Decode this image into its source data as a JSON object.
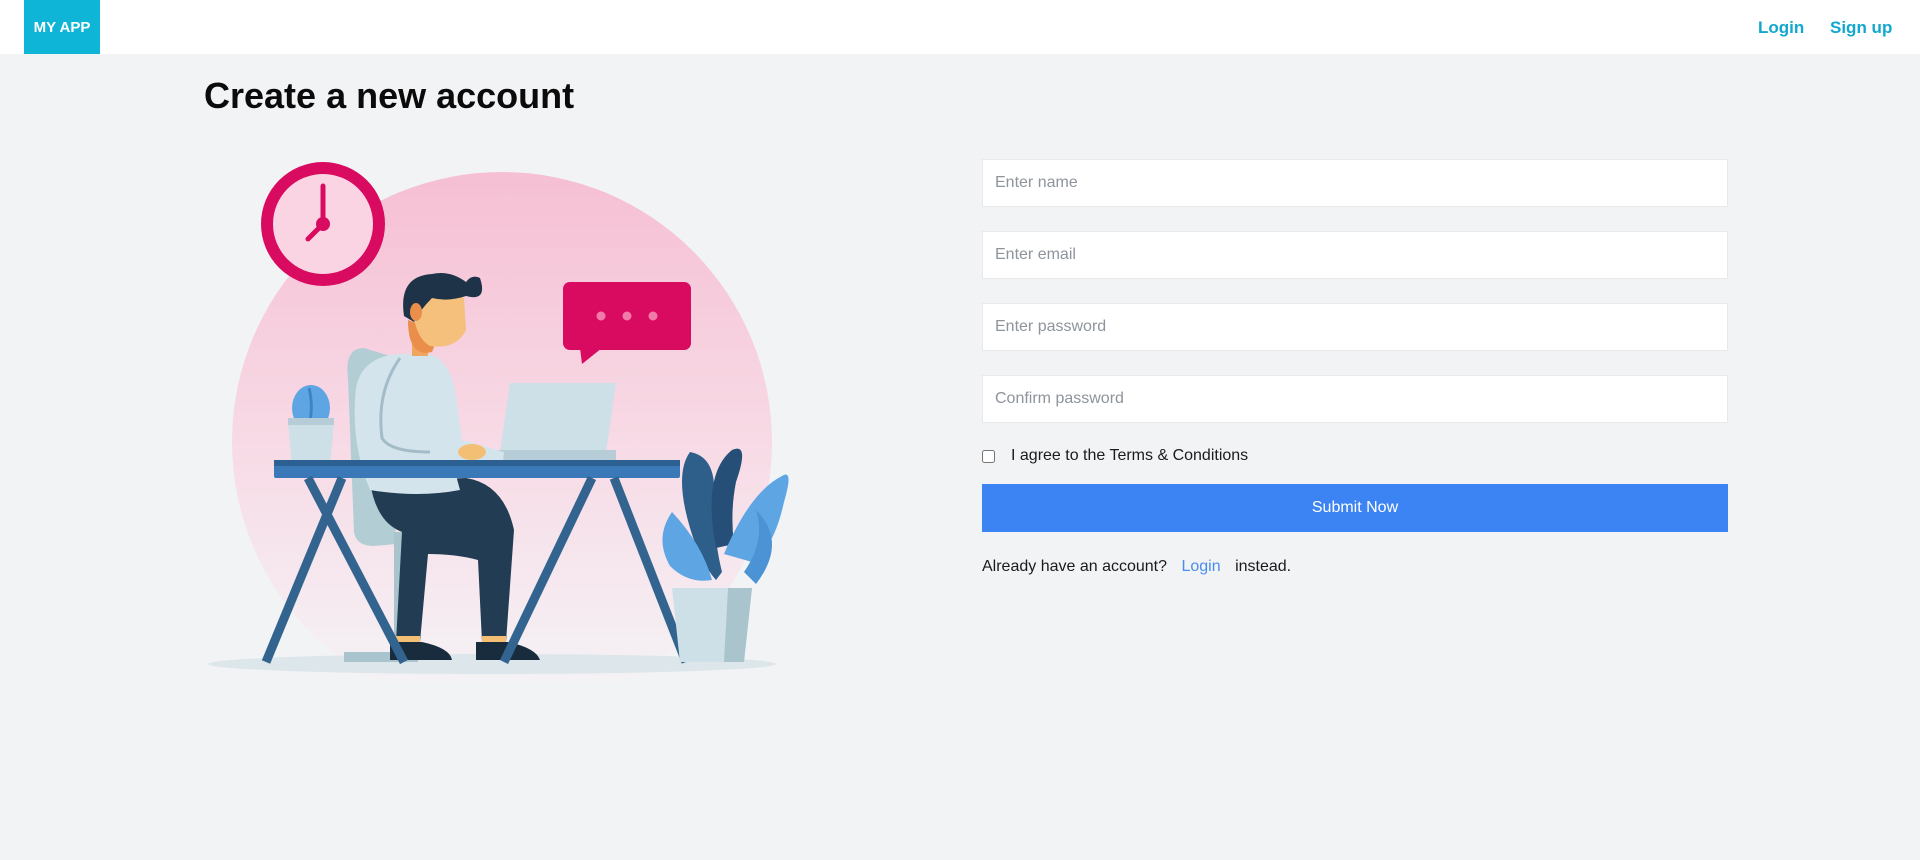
{
  "navbar": {
    "brand": "MY APP",
    "login_label": "Login",
    "signup_label": "Sign up"
  },
  "page": {
    "title": "Create a new account"
  },
  "form": {
    "name_placeholder": "Enter name",
    "email_placeholder": "Enter email",
    "password_placeholder": "Enter password",
    "confirm_placeholder": "Confirm password",
    "terms_label": "I agree to the Terms & Conditions",
    "terms_checked": false,
    "submit_label": "Submit Now",
    "already_prefix": "Already have an account?",
    "already_link": "Login",
    "already_suffix": "instead."
  },
  "colors": {
    "brand": "#0fb5d6",
    "nav_link": "#12a7cf",
    "submit": "#3c83f3",
    "link": "#4a8df0",
    "background": "#f2f3f5"
  },
  "illustration": {
    "icon_names": [
      "clock-icon",
      "chat-bubble-icon",
      "laptop-icon",
      "desk-icon",
      "potted-plant-icon",
      "cactus-icon",
      "person-icon"
    ]
  }
}
